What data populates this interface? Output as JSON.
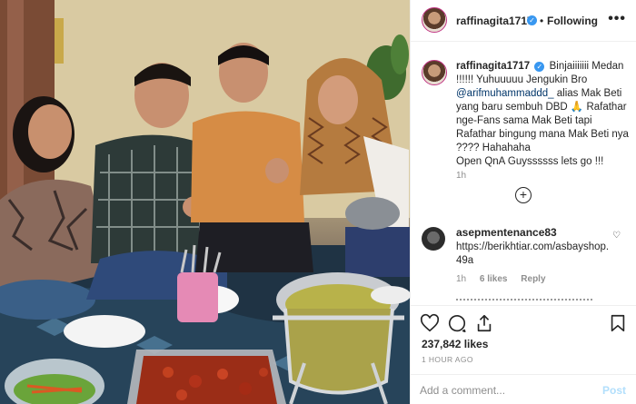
{
  "photo": {
    "alt_subject": "group-photo"
  },
  "header": {
    "username": "raffinagita1717",
    "verified_glyph": "✓",
    "separator": "•",
    "follow_state": "Following",
    "more_glyph": "•••"
  },
  "caption": {
    "username": "raffinagita1717",
    "verified_glyph": "✓",
    "line_intro": "Binjaiiiiiii Medan !!!!!! Yuhuuuuu Jengukin Bro",
    "mention": "@arifmuhammaddd_",
    "line_rest": " alias Mak Beti yang baru sembuh DBD 🙏 Rafathar nge-Fans sama Mak Beti tapi Rafathar bingung mana Mak Beti nya ???? Hahahaha",
    "line_last": "Open QnA Guyssssss lets go !!!",
    "time": "1h",
    "load_more_glyph": "+"
  },
  "comment": {
    "username": "asepmentenance83",
    "text": "https://berikhtiar.com/asbayshop.49a",
    "time": "1h",
    "likes": "6 likes",
    "reply": "Reply",
    "heart_glyph": "♡"
  },
  "actions": {
    "like_icon": "heart-icon",
    "comment_icon": "comment-icon",
    "share_icon": "share-icon",
    "save_icon": "bookmark-icon"
  },
  "likes": "237,842 likes",
  "posted": "1 HOUR AGO",
  "composer": {
    "placeholder": "Add a comment...",
    "post_label": "Post"
  },
  "colors": {
    "accent_blue": "#3897f0",
    "post_disabled": "#b2dffc",
    "meta_gray": "#8e8e8e"
  }
}
